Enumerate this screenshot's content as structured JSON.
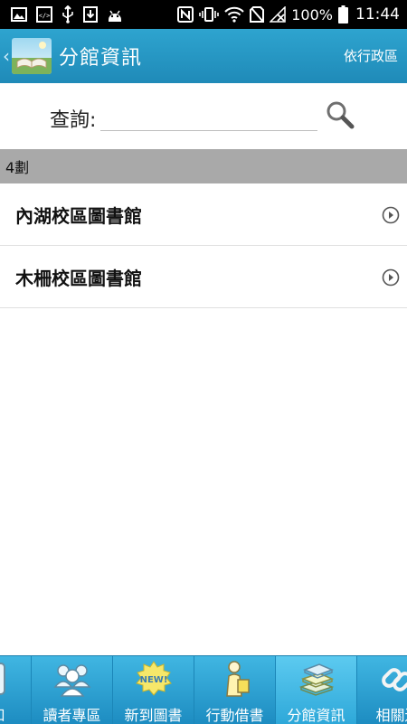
{
  "status_bar": {
    "battery_text": "100%",
    "time": "11:44"
  },
  "action_bar": {
    "title": "分館資訊",
    "sort_label": "依行政區"
  },
  "search": {
    "label": "查詢:",
    "value": "",
    "placeholder": ""
  },
  "section": {
    "header": "4劃"
  },
  "list": {
    "items": [
      {
        "label": "內湖校區圖書館"
      },
      {
        "label": "木柵校區圖書館"
      }
    ]
  },
  "tabs": [
    {
      "label": "通知",
      "icon": "notice-icon"
    },
    {
      "label": "讀者專區",
      "icon": "users-icon"
    },
    {
      "label": "新到圖書",
      "icon": "new-badge-icon"
    },
    {
      "label": "行動借書",
      "icon": "reading-person-icon"
    },
    {
      "label": "分館資訊",
      "icon": "books-stack-icon",
      "active": true
    },
    {
      "label": "相關連",
      "icon": "link-icon"
    }
  ],
  "colors": {
    "primary": "#2196c8",
    "section_header": "#a9a9a9",
    "tab_bar": "#2fa6d6"
  }
}
